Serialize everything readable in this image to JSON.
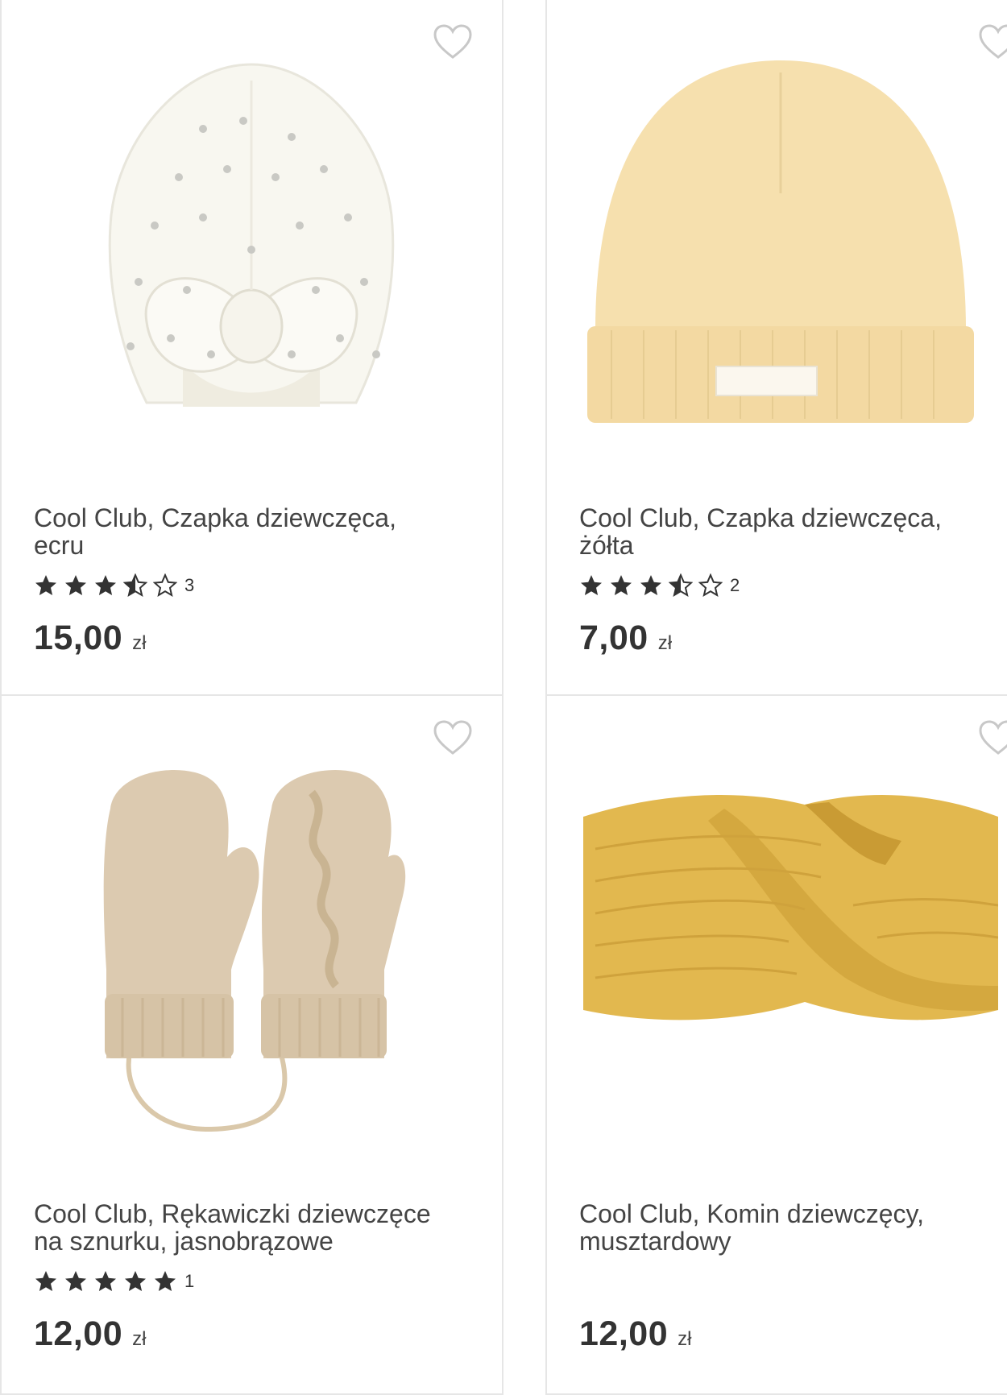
{
  "products": [
    {
      "name": "Cool Club, Czapka dziewczęca,\necru",
      "rating_value": 3.5,
      "reviews": "3",
      "price": "15,00",
      "currency": "zł",
      "image_icon": "turban-hat-icon"
    },
    {
      "name": "Cool Club, Czapka dziewczęca,\nżółta",
      "rating_value": 3.5,
      "reviews": "2",
      "price": "7,00",
      "currency": "zł",
      "image_icon": "beanie-hat-icon"
    },
    {
      "name": "Cool Club, Rękawiczki dziewczęce\nna sznurku, jasnobrązowe",
      "rating_value": 5,
      "reviews": "1",
      "price": "12,00",
      "currency": "zł",
      "image_icon": "mittens-icon"
    },
    {
      "name": "Cool Club, Komin dziewczęcy,\nmusztardowy",
      "rating_value": 0,
      "reviews": "",
      "price": "12,00",
      "currency": "zł",
      "image_icon": "knit-snood-icon"
    }
  ],
  "colors": {
    "text": "#444444",
    "border": "#e6e6e6",
    "star": "#333333",
    "heart_outline": "#c8c8c8"
  }
}
